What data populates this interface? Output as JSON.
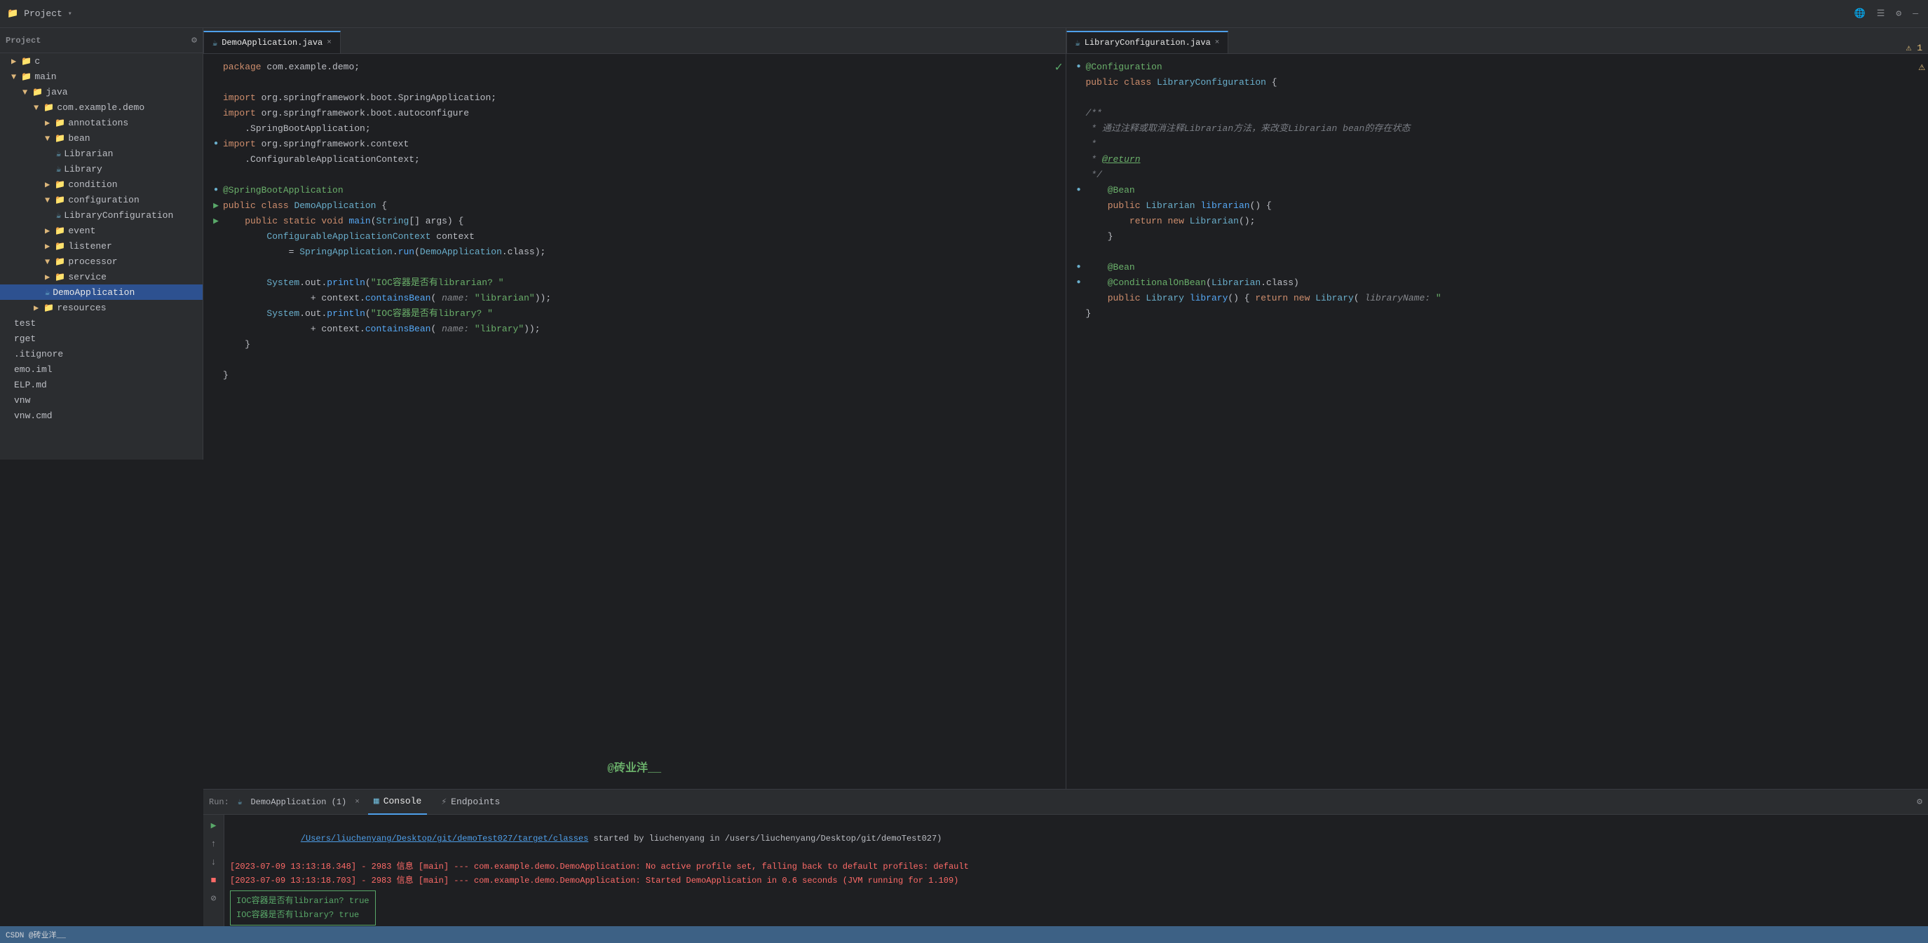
{
  "toolbar": {
    "project_label": "Project",
    "dropdown_arrow": "▾"
  },
  "tabs_left": {
    "tabs": [
      {
        "label": "DemoApplication.java",
        "active": true,
        "icon": "☕"
      },
      {
        "label": "LibraryConfiguration.java",
        "active": false,
        "icon": "☕"
      }
    ]
  },
  "sidebar": {
    "items": [
      {
        "label": "c",
        "indent": 0,
        "type": "text"
      },
      {
        "label": "main",
        "indent": 0,
        "type": "folder",
        "open": true
      },
      {
        "label": "java",
        "indent": 1,
        "type": "folder",
        "open": true
      },
      {
        "label": "com.example.demo",
        "indent": 2,
        "type": "folder",
        "open": true
      },
      {
        "label": "annotations",
        "indent": 3,
        "type": "folder",
        "open": false
      },
      {
        "label": "bean",
        "indent": 3,
        "type": "folder",
        "open": true
      },
      {
        "label": "Librarian",
        "indent": 4,
        "type": "java"
      },
      {
        "label": "Library",
        "indent": 4,
        "type": "java"
      },
      {
        "label": "condition",
        "indent": 3,
        "type": "folder",
        "open": false
      },
      {
        "label": "configuration",
        "indent": 3,
        "type": "folder",
        "open": true
      },
      {
        "label": "LibraryConfiguration",
        "indent": 4,
        "type": "java"
      },
      {
        "label": "event",
        "indent": 3,
        "type": "folder",
        "open": false
      },
      {
        "label": "listener",
        "indent": 3,
        "type": "folder",
        "open": false
      },
      {
        "label": "processor",
        "indent": 3,
        "type": "folder",
        "open": false
      },
      {
        "label": "service",
        "indent": 3,
        "type": "folder",
        "open": false
      },
      {
        "label": "DemoApplication",
        "indent": 3,
        "type": "java",
        "selected": true
      },
      {
        "label": "resources",
        "indent": 2,
        "type": "folder",
        "open": false
      },
      {
        "label": "test",
        "indent": 0,
        "type": "text"
      },
      {
        "label": "rget",
        "indent": 0,
        "type": "text"
      },
      {
        "label": ".itignore",
        "indent": 0,
        "type": "text"
      },
      {
        "label": "emo.iml",
        "indent": 0,
        "type": "text"
      },
      {
        "label": "HELP.md",
        "indent": 0,
        "type": "text"
      },
      {
        "label": "mvnw",
        "indent": 0,
        "type": "text"
      },
      {
        "label": "mvnw.cmd",
        "indent": 0,
        "type": "text"
      }
    ]
  },
  "editor_left": {
    "lines": [
      {
        "num": "",
        "code": "package com.example.demo;"
      },
      {
        "num": "",
        "code": ""
      },
      {
        "num": "",
        "code": "import org.springframework.boot.SpringApplication;"
      },
      {
        "num": "",
        "code": "import org.springframework.boot.autoconfigure"
      },
      {
        "num": "",
        "code": "    .SpringBootApplication;"
      },
      {
        "num": "",
        "code": "import org.springframework.context"
      },
      {
        "num": "",
        "code": "    .ConfigurableApplicationContext;"
      },
      {
        "num": "",
        "code": ""
      },
      {
        "num": "",
        "code": "@SpringBootApplication"
      },
      {
        "num": "",
        "code": "public class DemoApplication {"
      },
      {
        "num": "",
        "code": "    public static void main(String[] args) {"
      },
      {
        "num": "",
        "code": "        ConfigurableApplicationContext context"
      },
      {
        "num": "",
        "code": "            = SpringApplication.run(DemoApplication.class);"
      },
      {
        "num": "",
        "code": ""
      },
      {
        "num": "",
        "code": "        System.out.println(\"IOC容器是否有librarian? \""
      },
      {
        "num": "",
        "code": "                + context.containsBean( name: \"librarian\"));"
      },
      {
        "num": "",
        "code": "        System.out.println(\"IOC容器是否有library? \""
      },
      {
        "num": "",
        "code": "                + context.containsBean( name: \"library\"));"
      },
      {
        "num": "",
        "code": "    }"
      },
      {
        "num": "",
        "code": ""
      },
      {
        "num": "",
        "code": "}"
      }
    ]
  },
  "editor_right": {
    "lines": [
      {
        "code": "@Configuration"
      },
      {
        "code": "public class LibraryConfiguration {"
      },
      {
        "code": ""
      },
      {
        "code": "    /**"
      },
      {
        "code": "     * 通过注释或取消注释Librarian方法，来改变Librarian bean的存在状态"
      },
      {
        "code": "     *"
      },
      {
        "code": "     * @return"
      },
      {
        "code": "     */"
      },
      {
        "code": "    @Bean"
      },
      {
        "code": "    public Librarian librarian() {"
      },
      {
        "code": "        return new Librarian();"
      },
      {
        "code": "    }"
      },
      {
        "code": ""
      },
      {
        "code": "    @Bean"
      },
      {
        "code": "    @ConditionalOnBean(Librarian.class)"
      },
      {
        "code": "    public Library library() { return new Library( libraryName: \""
      },
      {
        "code": "}"
      }
    ]
  },
  "run_panel": {
    "title": "Run:",
    "app_name": "DemoApplication (1)",
    "tabs": [
      {
        "label": "Console",
        "active": true
      },
      {
        "label": "Endpoints",
        "active": false
      }
    ],
    "log_lines": [
      {
        "type": "link",
        "text": "/Users/liuchenyang/Desktop/git/demoTest027/target/classes"
      },
      {
        "type": "info",
        "text": " started by liuchenyang in /users/liuchenyang/Desktop/git/demoTest027)"
      },
      {
        "type": "error",
        "text": "[2023-07-09 13:13:18.348] - 2983 信息 [main] --- com.example.demo.DemoApplication: No active profile set, falling back to default profiles: default"
      },
      {
        "type": "error",
        "text": "[2023-07-09 13:13:18.703] - 2983 信息 [main] --- com.example.demo.DemoApplication: Started DemoApplication in 0.6 seconds (JVM running for 1.109)"
      },
      {
        "type": "console",
        "text": "IOC容器是否有librarian? true\nIOC容器是否有library? true"
      }
    ]
  },
  "status_bar": {
    "left": "CSDN @砖业洋__",
    "watermark": "@砖业洋__"
  }
}
